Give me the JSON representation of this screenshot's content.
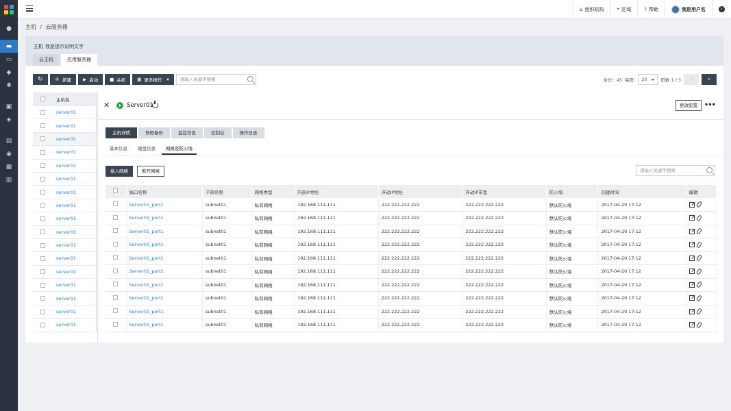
{
  "nav": {
    "org": "组织机构",
    "region": "区域",
    "help": "帮助",
    "user": "我是用户名"
  },
  "breadcrumb": {
    "home": "主机",
    "sep": "/",
    "current": "云服务器"
  },
  "page": {
    "title": "主机",
    "hint": "我是提示说明文字",
    "tabs": [
      "云主机",
      "应用服务器"
    ]
  },
  "toolbar": {
    "new": "新建",
    "start": "启动",
    "stop": "关机",
    "more": "更多操作",
    "search_placeholder": "请输入关键字搜索"
  },
  "pager": {
    "total": "合计：45",
    "per_page_label": "每页:",
    "per_page": "20",
    "page": "页数 1 / 3"
  },
  "host_list": {
    "header": "主机名",
    "items": [
      "server01",
      "server01",
      "server01",
      "server01",
      "server01",
      "server01",
      "server01",
      "server01",
      "server01",
      "server01",
      "server01",
      "server01",
      "server01",
      "server01",
      "server01",
      "server01",
      "server01"
    ]
  },
  "detail": {
    "server_name": "Server01",
    "change_config": "更改配置",
    "tabs": [
      "主机详情",
      "快照备份",
      "监控信息",
      "控制台",
      "操作日志"
    ],
    "subtabs": [
      "基本信息",
      "硬盘信息",
      "网络及防火墙"
    ],
    "attach_network": "接入网络",
    "detach_network": "断开网络",
    "search_placeholder": "请输入关键字搜索",
    "columns": [
      "端口名称",
      "子网名称",
      "网络类型",
      "内部IP地址",
      "浮动IP地址",
      "浮动IP带宽",
      "防火墙",
      "创建时间",
      "编辑"
    ],
    "rows": [
      [
        "Server01_port1",
        "subnet01",
        "私有网络",
        "192.168.111.111",
        "222.222.222.222",
        "222.222.222.222",
        "默认防火墙",
        "2017-04-20 17:12"
      ],
      [
        "Server01_port1",
        "subnet01",
        "私有网络",
        "192.168.111.111",
        "222.222.222.222",
        "222.222.222.222",
        "默认防火墙",
        "2017-04-20 17:12"
      ],
      [
        "Server01_port1",
        "subnet01",
        "私有网络",
        "192.168.111.111",
        "222.222.222.222",
        "222.222.222.222",
        "默认防火墙",
        "2017-04-20 17:12"
      ],
      [
        "Server01_port1",
        "subnet01",
        "私有网络",
        "192.168.111.111",
        "222.222.222.222",
        "222.222.222.222",
        "默认防火墙",
        "2017-04-20 17:12"
      ],
      [
        "Server01_port1",
        "subnet01",
        "私有网络",
        "192.168.111.111",
        "222.222.222.222",
        "222.222.222.222",
        "默认防火墙",
        "2017-04-20 17:12"
      ],
      [
        "Server01_port1",
        "subnet01",
        "私有网络",
        "192.168.111.111",
        "222.222.222.222",
        "222.222.222.222",
        "默认防火墙",
        "2017-04-20 17:12"
      ],
      [
        "Server01_port1",
        "subnet01",
        "私有网络",
        "192.168.111.111",
        "222.222.222.222",
        "222.222.222.222",
        "默认防火墙",
        "2017-04-20 17:12"
      ],
      [
        "Server01_port1",
        "subnet01",
        "私有网络",
        "192.168.111.111",
        "222.222.222.222",
        "222.222.222.222",
        "默认防火墙",
        "2017-04-20 17:12"
      ],
      [
        "Server01_port1",
        "subnet01",
        "私有网络",
        "192.168.111.111",
        "222.222.222.222",
        "222.222.222.222",
        "默认防火墙",
        "2017-04-20 17:12"
      ],
      [
        "Server01_port1",
        "subnet01",
        "私有网络",
        "192.168.111.111",
        "222.222.222.222",
        "222.222.222.222",
        "默认防火墙",
        "2017-04-20 17:12"
      ]
    ]
  },
  "colors": {
    "sidebar": "#2b3240",
    "accent": "#2d7ac8",
    "dark_button": "#3a4350",
    "running": "#28a745"
  }
}
